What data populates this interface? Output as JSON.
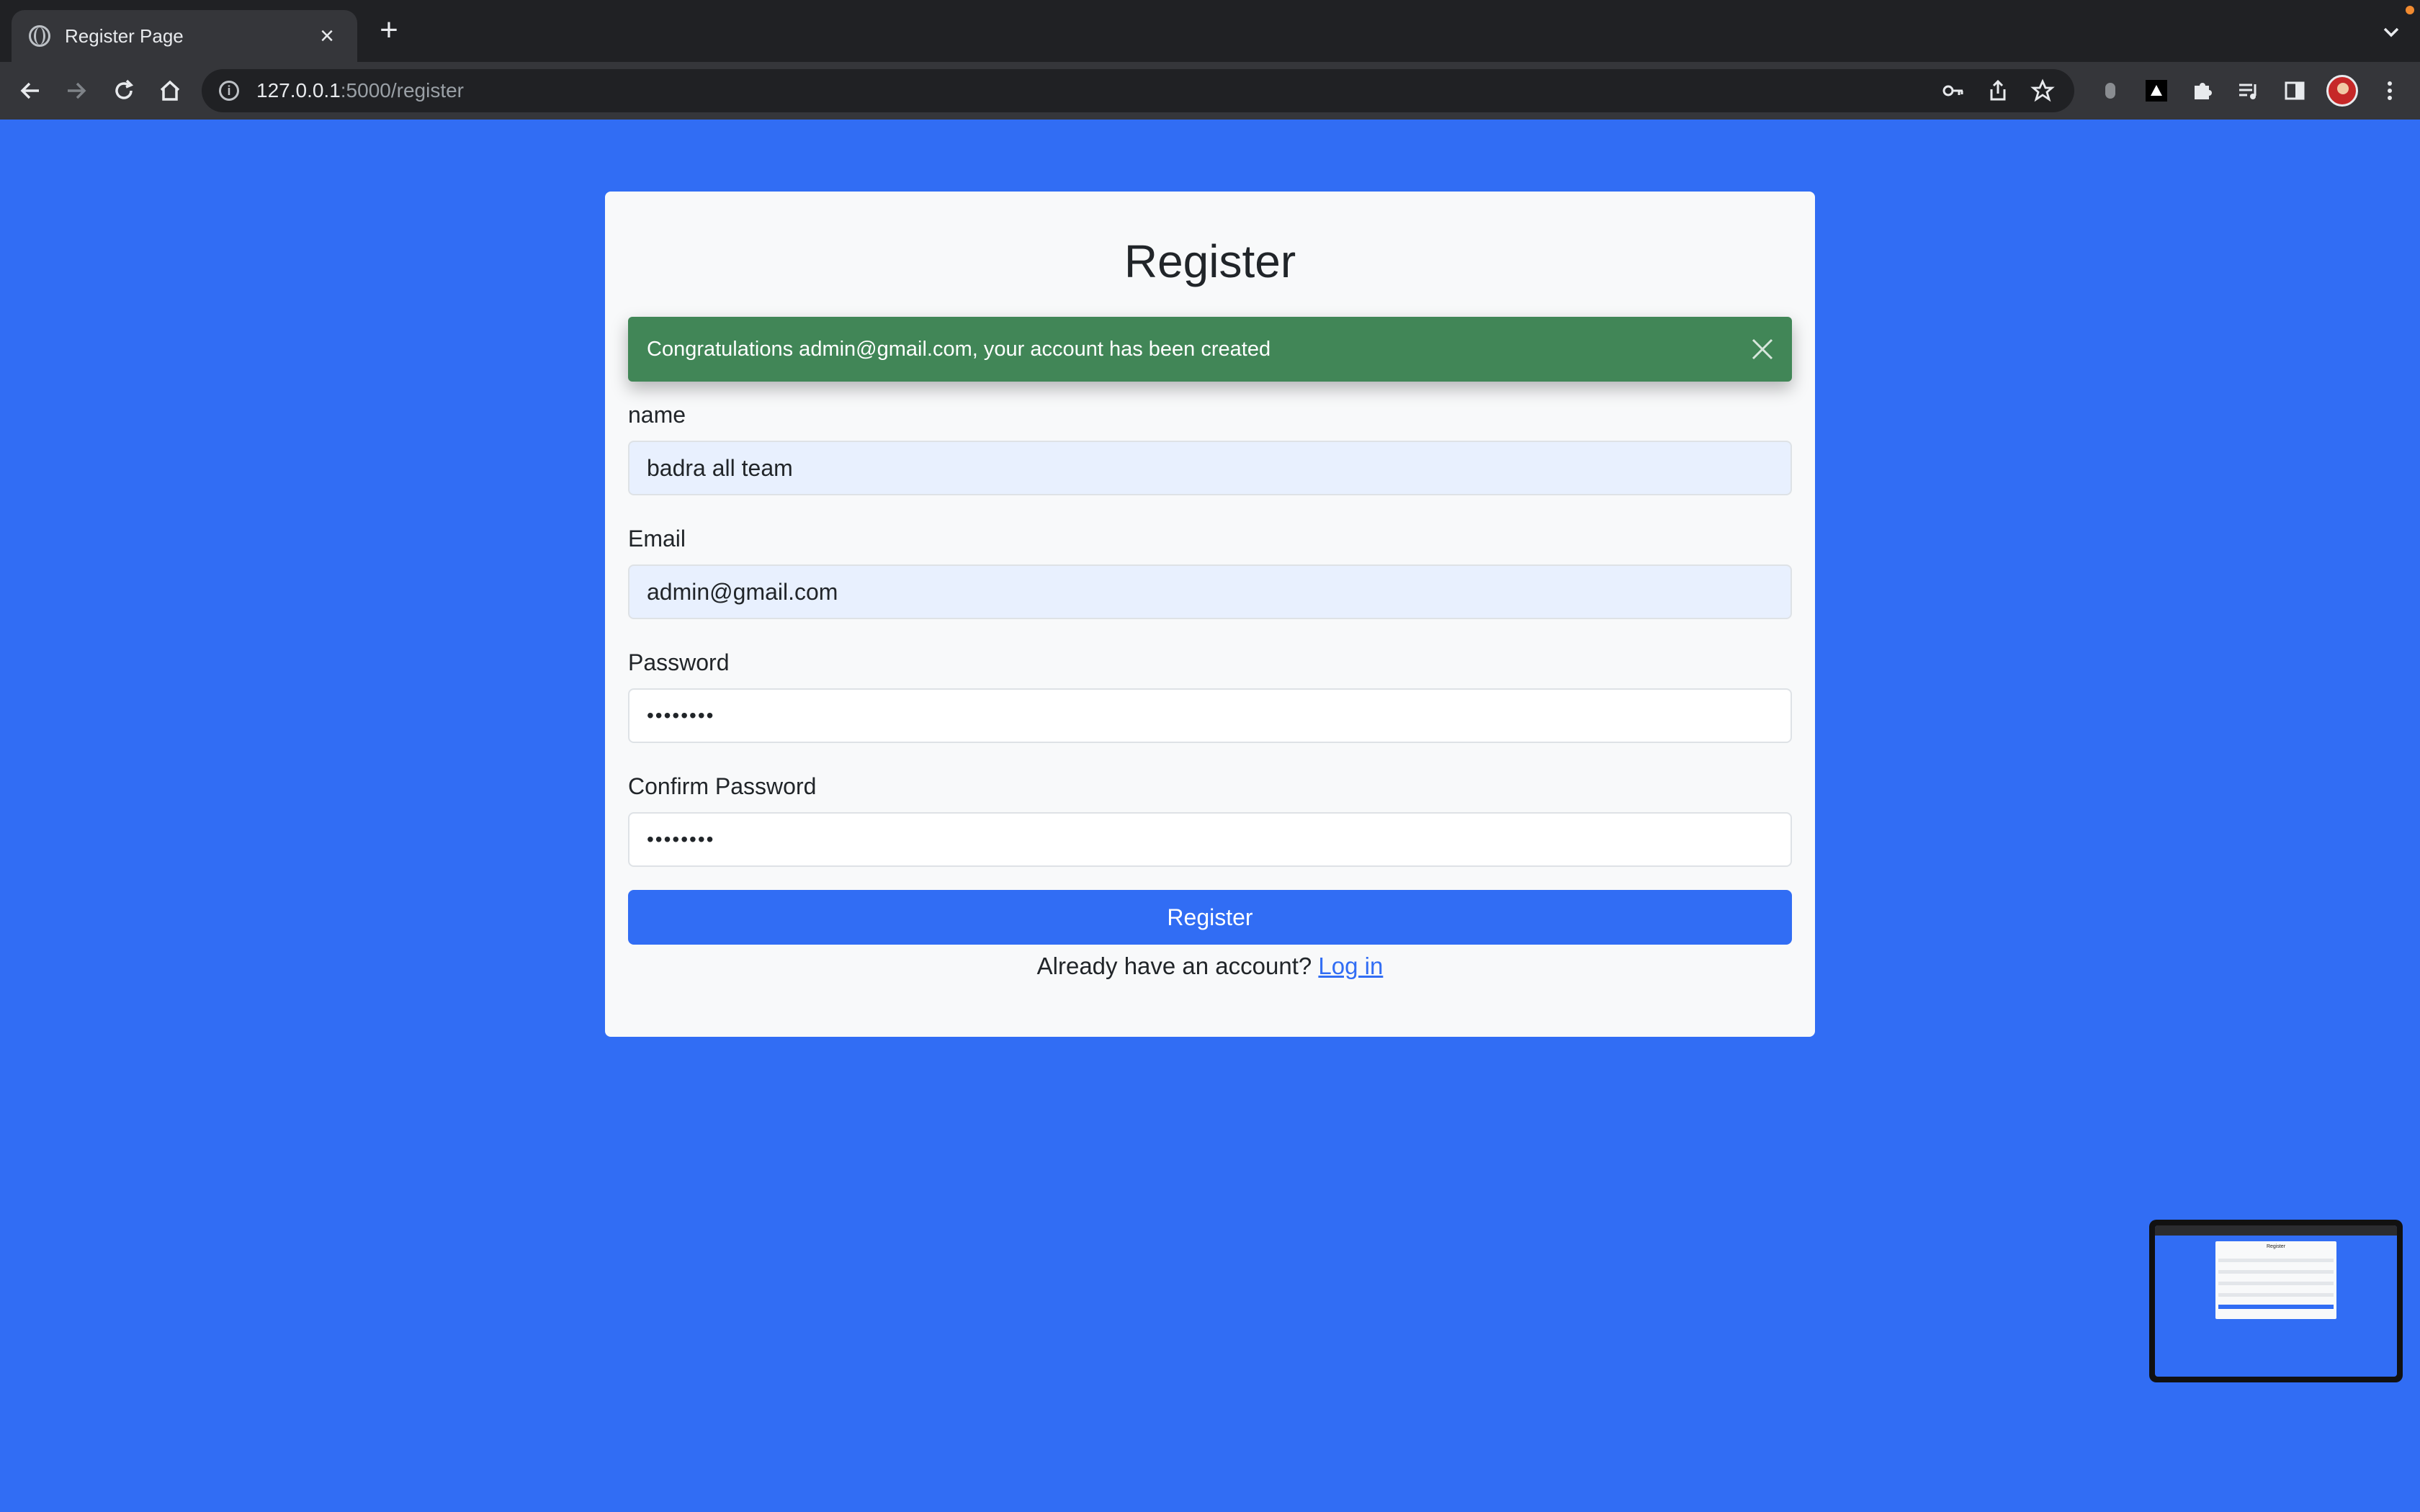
{
  "browser": {
    "tab_title": "Register Page",
    "url_host": "127.0.0.1",
    "url_rest": ":5000/register",
    "icons": {
      "back": "arrow-left-icon",
      "forward": "arrow-right-icon",
      "reload": "reload-icon",
      "home": "home-icon",
      "site_info": "info-icon",
      "password": "key-icon",
      "share": "share-icon",
      "bookmark": "star-icon",
      "extensions": "puzzle-icon",
      "menu": "kebab-icon"
    }
  },
  "page": {
    "title": "Register",
    "alert": {
      "message": "Congratulations admin@gmail.com, your account has been created",
      "color": "#418657"
    },
    "form": {
      "name_label": "name",
      "name_value": "badra all team",
      "email_label": "Email",
      "email_value": "admin@gmail.com",
      "password_label": "Password",
      "password_value": "••••••••",
      "confirm_label": "Confirm Password",
      "confirm_value": "••••••••",
      "submit_label": "Register"
    },
    "footer": {
      "prompt": "Already have an account?",
      "login_link": "Log in"
    }
  },
  "pip": {
    "title": "Register"
  },
  "colors": {
    "background": "#316df4",
    "accent": "#316df4",
    "card": "#f8f9fa",
    "autofill": "#e8f0fe"
  }
}
